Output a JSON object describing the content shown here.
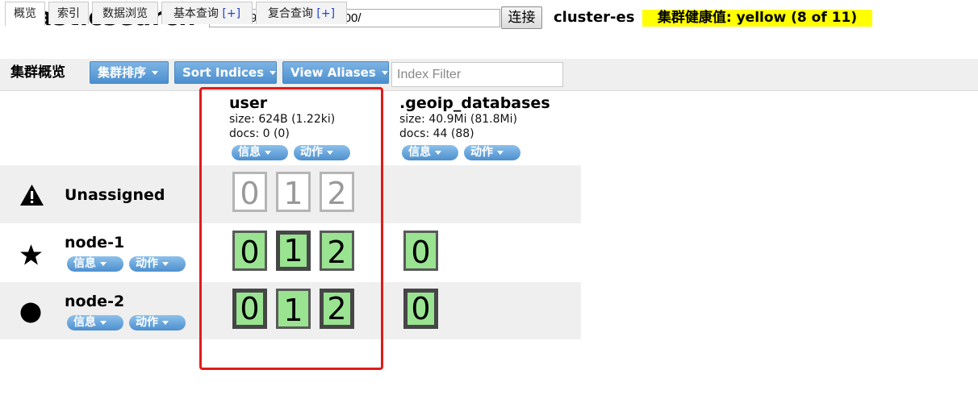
{
  "header": {
    "app_title": "Elasticsearch",
    "url_value": "http://192.168.40.130:9200/",
    "connect_label": "连接",
    "cluster_name": "cluster-es",
    "health_label": "集群健康值: yellow (8 of 11)",
    "health_color": "#ffff00"
  },
  "tabs": [
    {
      "label": "概览",
      "active": true
    },
    {
      "label": "索引",
      "active": false
    },
    {
      "label": "数据浏览",
      "active": false
    },
    {
      "label": "基本查询",
      "plus": "[+]",
      "active": false
    },
    {
      "label": "复合查询",
      "plus": "[+]",
      "active": false
    }
  ],
  "toolbar": {
    "title": "集群概览",
    "sort_cluster_label": "集群排序",
    "sort_indices_label": "Sort Indices",
    "view_aliases_label": "View Aliases",
    "filter_placeholder": "Index Filter"
  },
  "indices": [
    {
      "name": "user",
      "size": "size: 624B (1.22ki)",
      "docs": "docs: 0 (0)",
      "info_label": "信息",
      "action_label": "动作"
    },
    {
      "name": ".geoip_databases",
      "size": "size: 40.9Mi (81.8Mi)",
      "docs": "docs: 44 (88)",
      "info_label": "信息",
      "action_label": "动作"
    }
  ],
  "rows": [
    {
      "name": "Unassigned",
      "icon": "warning-icon",
      "user_shards": [
        "0",
        "1",
        "2"
      ],
      "geoip_shards": []
    },
    {
      "name": "node-1",
      "icon": "star-icon",
      "info_label": "信息",
      "action_label": "动作",
      "user_shards": [
        "0",
        "1",
        "2"
      ],
      "geoip_shards": [
        "0"
      ]
    },
    {
      "name": "node-2",
      "icon": "circle-icon",
      "info_label": "信息",
      "action_label": "动作",
      "user_shards": [
        "0",
        "1",
        "2"
      ],
      "geoip_shards": [
        "0"
      ]
    }
  ],
  "colors": {
    "shard_active": "#99e391",
    "button_blue": "#4b8fcf",
    "highlight": "#e31a1a"
  }
}
